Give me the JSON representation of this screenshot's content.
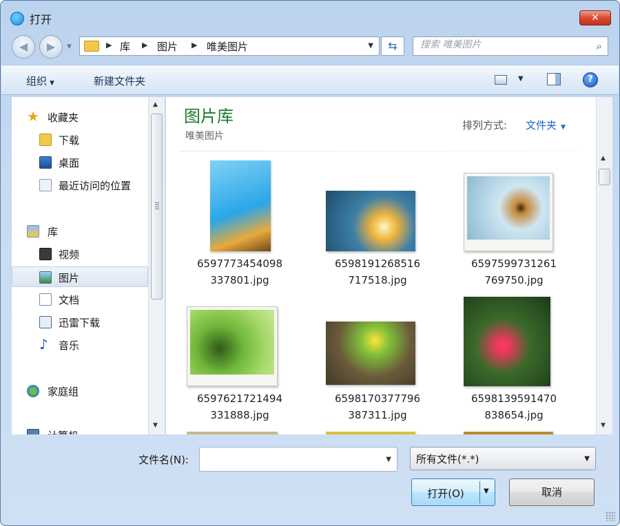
{
  "window": {
    "title": "打开",
    "close_label": "✕"
  },
  "address": {
    "crumbs": [
      "库",
      "图片",
      "唯美图片"
    ],
    "search_placeholder": "搜索 唯美图片"
  },
  "toolbar": {
    "organize": "组织",
    "new_folder": "新建文件夹"
  },
  "nav": {
    "favorites": "收藏夹",
    "downloads": "下载",
    "desktop": "桌面",
    "recent": "最近访问的位置",
    "libraries": "库",
    "videos": "视频",
    "pictures": "图片",
    "documents": "文档",
    "thunder": "迅雷下载",
    "music": "音乐",
    "homegroup": "家庭组",
    "computer": "计算机"
  },
  "content": {
    "title": "图片库",
    "subtitle": "唯美图片",
    "sort_label": "排列方式:",
    "sort_value": "文件夹",
    "files": [
      {
        "line1": "6597773454098",
        "line2": "337801.jpg"
      },
      {
        "line1": "6598191268516",
        "line2": "717518.jpg"
      },
      {
        "line1": "6597599731261",
        "line2": "769750.jpg"
      },
      {
        "line1": "6597621721494",
        "line2": "331888.jpg"
      },
      {
        "line1": "6598170377796",
        "line2": "387311.jpg"
      },
      {
        "line1": "6598139591470",
        "line2": "838654.jpg"
      }
    ]
  },
  "bottom": {
    "filename_label": "文件名(N):",
    "filename_value": "",
    "filetype_value": "所有文件(*.*)",
    "open_label": "打开(O)",
    "cancel_label": "取消"
  },
  "colors": {
    "accent": "#1a66c2",
    "library_title": "#1e7a2e",
    "close": "#d8492f"
  }
}
